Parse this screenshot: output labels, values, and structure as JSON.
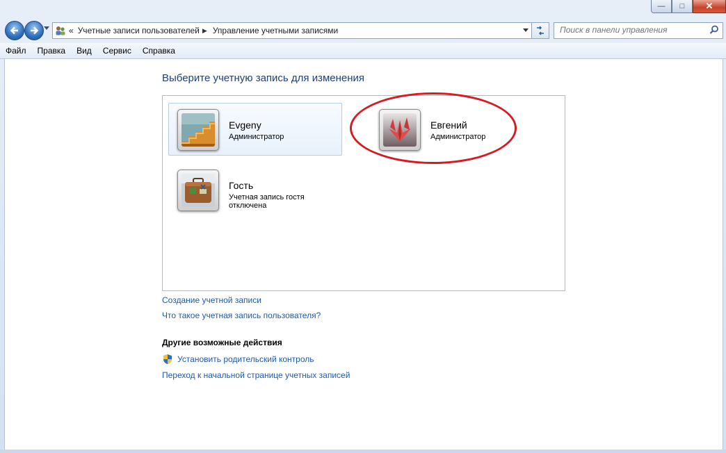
{
  "window": {
    "controls": {
      "minimize": "—",
      "maximize": "□",
      "close": "✕"
    }
  },
  "address": {
    "overflow_chevron": "«",
    "breadcrumb": [
      "Учетные записи пользователей",
      "Управление учетными записями"
    ],
    "search_placeholder": "Поиск в панели управления"
  },
  "menu": [
    "Файл",
    "Правка",
    "Вид",
    "Сервис",
    "Справка"
  ],
  "main": {
    "heading": "Выберите учетную запись для изменения",
    "accounts": [
      {
        "name": "Evgeny",
        "role": "Администратор",
        "picture": "stairs-picture",
        "selected": true
      },
      {
        "name": "Евгений",
        "role": "Администратор",
        "picture": "origami-crane-picture",
        "highlighted": true,
        "highlight_color": "#d41c22"
      },
      {
        "name": "Гость",
        "role": "Учетная запись гостя отключена",
        "picture": "suitcase-picture"
      }
    ],
    "links": [
      "Создание учетной записи",
      "Что такое учетная запись пользователя?"
    ],
    "other_actions": {
      "heading": "Другие возможные действия",
      "parental_control": "Установить родительский контроль",
      "accounts_home": "Переход к начальной странице учетных записей"
    }
  },
  "colors": {
    "link": "#1e5aa8",
    "heading": "#1e3f7a",
    "highlight": "#d41c22"
  }
}
